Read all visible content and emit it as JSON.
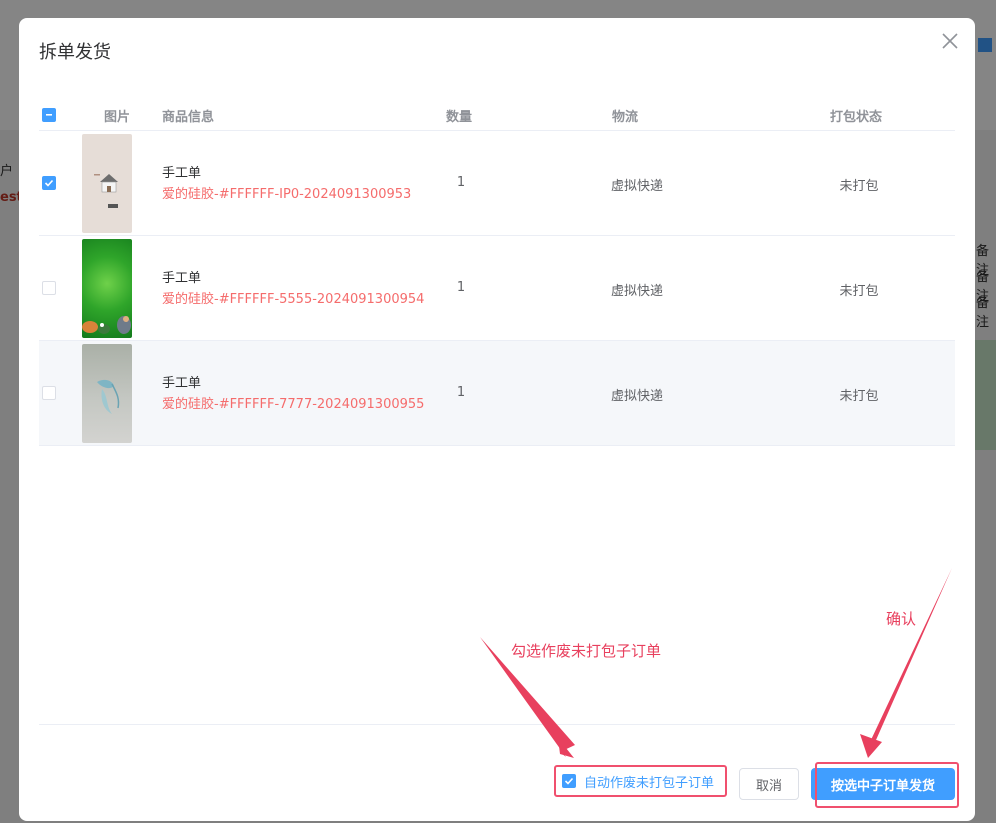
{
  "dialog": {
    "title": "拆单发货",
    "close_icon": "close-icon"
  },
  "table": {
    "headers": {
      "image": "图片",
      "product_info": "商品信息",
      "quantity": "数量",
      "logistics": "物流",
      "pack_status": "打包状态"
    },
    "header_checkbox_state": "indeterminate",
    "rows": [
      {
        "checked": true,
        "name": "手工单",
        "sku": "爱的硅胶-#FFFFFF-IP0-2024091300953",
        "quantity": "1",
        "logistics": "虚拟快递",
        "pack_status": "未打包",
        "thumb": "house-product-image"
      },
      {
        "checked": false,
        "name": "手工单",
        "sku": "爱的硅胶-#FFFFFF-5555-2024091300954",
        "quantity": "1",
        "logistics": "虚拟快递",
        "pack_status": "未打包",
        "thumb": "green-product-image"
      },
      {
        "checked": false,
        "name": "手工单",
        "sku": "爱的硅胶-#FFFFFF-7777-2024091300955",
        "quantity": "1",
        "logistics": "虚拟快递",
        "pack_status": "未打包",
        "thumb": "gray-product-image"
      }
    ]
  },
  "footer": {
    "auto_void_label": "自动作废未打包子订单",
    "auto_void_checked": true,
    "cancel_label": "取消",
    "confirm_label": "按选中子订单发货"
  },
  "annotations": {
    "checkbox_hint": "勾选作废未打包子订单",
    "confirm_hint": "确认",
    "color": "#e8405e"
  },
  "colors": {
    "primary": "#409eff",
    "sku_red": "#f56c6c"
  },
  "background": {
    "fragments": [
      "户",
      "est",
      "备注",
      "备注",
      "备注"
    ]
  }
}
